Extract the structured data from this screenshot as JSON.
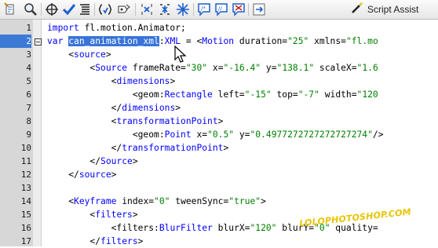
{
  "toolbar": {
    "buttons": [
      "add-statement-icon",
      "find-icon",
      "target-icon",
      "check-syntax-icon",
      "auto-format-icon",
      "code-hint-icon",
      "debug-options-icon",
      "collapse-between-braces-icon",
      "collapse-selection-icon",
      "expand-all-icon",
      "apply-block-comment-icon",
      "apply-line-comment-icon",
      "remove-comment-icon",
      "show-hide-toolbox-icon"
    ],
    "script_assist_label": "Script Assist"
  },
  "editor": {
    "line_numbers": [
      "1",
      "2",
      "3",
      "4",
      "5",
      "6",
      "7",
      "8",
      "9",
      "10",
      "11",
      "12",
      "13",
      "14",
      "15",
      "16",
      "17"
    ],
    "highlighted_line": "2",
    "lines": [
      {
        "indent": "",
        "parts": [
          [
            "kw",
            "import"
          ],
          [
            "tx",
            " fl.motion.Animator;"
          ]
        ]
      },
      {
        "indent": "",
        "parts": [
          [
            "kw",
            "var"
          ],
          [
            "tx",
            " "
          ],
          [
            "sel",
            "can_animation_xml"
          ],
          [
            "tx",
            ":"
          ],
          [
            "kw",
            "XML"
          ],
          [
            "tx",
            " = <"
          ],
          [
            "tg",
            "Motion"
          ],
          [
            "tx",
            " duration="
          ],
          [
            "st",
            "\"25\""
          ],
          [
            "tx",
            " xmlns="
          ],
          [
            "st",
            "\"fl.mo"
          ]
        ]
      },
      {
        "indent": "    ",
        "parts": [
          [
            "tx",
            "<"
          ],
          [
            "tg",
            "source"
          ],
          [
            "tx",
            ">"
          ]
        ]
      },
      {
        "indent": "        ",
        "parts": [
          [
            "tx",
            "<"
          ],
          [
            "tg",
            "Source"
          ],
          [
            "tx",
            " frameRate="
          ],
          [
            "st",
            "\"30\""
          ],
          [
            "tx",
            " x="
          ],
          [
            "st",
            "\"-16.4\""
          ],
          [
            "tx",
            " y="
          ],
          [
            "st",
            "\"138.1\""
          ],
          [
            "tx",
            " scaleX="
          ],
          [
            "st",
            "\"1.6"
          ]
        ]
      },
      {
        "indent": "            ",
        "parts": [
          [
            "tx",
            "<"
          ],
          [
            "tg",
            "dimensions"
          ],
          [
            "tx",
            ">"
          ]
        ]
      },
      {
        "indent": "                ",
        "parts": [
          [
            "tx",
            "<geom:"
          ],
          [
            "tg",
            "Rectangle"
          ],
          [
            "tx",
            " left="
          ],
          [
            "st",
            "\"-15\""
          ],
          [
            "tx",
            " top="
          ],
          [
            "st",
            "\"-7\""
          ],
          [
            "tx",
            " width="
          ],
          [
            "st",
            "\"120"
          ]
        ]
      },
      {
        "indent": "            ",
        "parts": [
          [
            "tx",
            "</"
          ],
          [
            "tg",
            "dimensions"
          ],
          [
            "tx",
            ">"
          ]
        ]
      },
      {
        "indent": "            ",
        "parts": [
          [
            "tx",
            "<"
          ],
          [
            "tg",
            "transformationPoint"
          ],
          [
            "tx",
            ">"
          ]
        ]
      },
      {
        "indent": "                ",
        "parts": [
          [
            "tx",
            "<geom:"
          ],
          [
            "tg",
            "Point"
          ],
          [
            "tx",
            " x="
          ],
          [
            "st",
            "\"0.5\""
          ],
          [
            "tx",
            " y="
          ],
          [
            "st",
            "\"0.4977272727272727274\""
          ],
          [
            "tx",
            "/>"
          ]
        ]
      },
      {
        "indent": "            ",
        "parts": [
          [
            "tx",
            "</"
          ],
          [
            "tg",
            "transformationPoint"
          ],
          [
            "tx",
            ">"
          ]
        ]
      },
      {
        "indent": "        ",
        "parts": [
          [
            "tx",
            "</"
          ],
          [
            "tg",
            "Source"
          ],
          [
            "tx",
            ">"
          ]
        ]
      },
      {
        "indent": "    ",
        "parts": [
          [
            "tx",
            "</"
          ],
          [
            "tg",
            "source"
          ],
          [
            "tx",
            ">"
          ]
        ]
      },
      {
        "indent": "",
        "parts": []
      },
      {
        "indent": "    ",
        "parts": [
          [
            "tx",
            "<"
          ],
          [
            "tg",
            "Keyframe"
          ],
          [
            "tx",
            " index="
          ],
          [
            "st",
            "\"0\""
          ],
          [
            "tx",
            " tweenSync="
          ],
          [
            "st",
            "\"true\""
          ],
          [
            "tx",
            ">"
          ]
        ]
      },
      {
        "indent": "        ",
        "parts": [
          [
            "tx",
            "<"
          ],
          [
            "tg",
            "filters"
          ],
          [
            "tx",
            ">"
          ]
        ]
      },
      {
        "indent": "            ",
        "parts": [
          [
            "tx",
            "<filters:"
          ],
          [
            "tg",
            "BlurFilter"
          ],
          [
            "tx",
            " blurX="
          ],
          [
            "st",
            "\"120\""
          ],
          [
            "tx",
            " blurY="
          ],
          [
            "st",
            "\"0\""
          ],
          [
            "tx",
            " quality="
          ]
        ]
      },
      {
        "indent": "        ",
        "parts": [
          [
            "tx",
            "</"
          ],
          [
            "tg",
            "filters"
          ],
          [
            "tx",
            ">"
          ]
        ]
      }
    ]
  },
  "watermark": "LOLOPHOTOSHOP.COM"
}
